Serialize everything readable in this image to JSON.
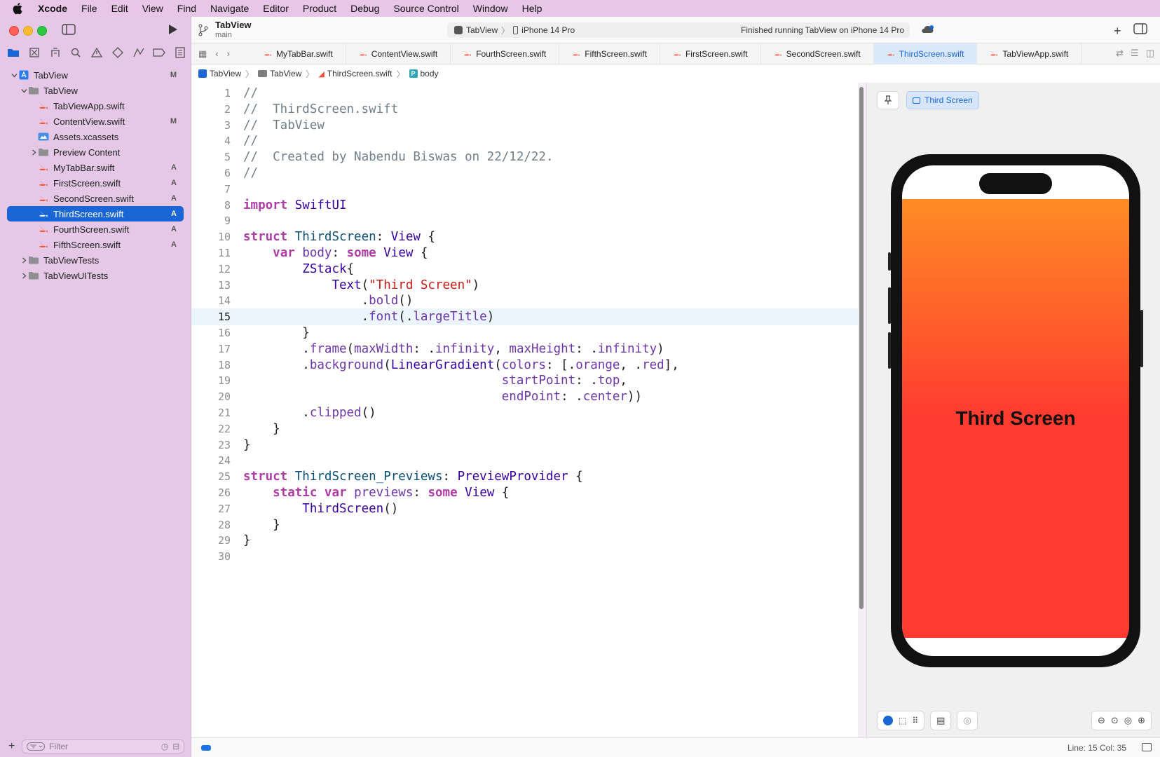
{
  "menubar": {
    "app": "Xcode",
    "items": [
      "File",
      "Edit",
      "View",
      "Find",
      "Navigate",
      "Editor",
      "Product",
      "Debug",
      "Source Control",
      "Window",
      "Help"
    ]
  },
  "navigator": {
    "tree": [
      {
        "label": "TabView",
        "badge": "M",
        "level": 0,
        "icon": "project-icon",
        "disclosure": "open"
      },
      {
        "label": "TabView",
        "badge": "",
        "level": 1,
        "icon": "folder-icon",
        "disclosure": "open"
      },
      {
        "label": "TabViewApp.swift",
        "badge": "",
        "level": 2,
        "icon": "swift-file-icon",
        "disclosure": "none"
      },
      {
        "label": "ContentView.swift",
        "badge": "M",
        "level": 2,
        "icon": "swift-file-icon",
        "disclosure": "none"
      },
      {
        "label": "Assets.xcassets",
        "badge": "",
        "level": 2,
        "icon": "assets-icon",
        "disclosure": "none"
      },
      {
        "label": "Preview Content",
        "badge": "",
        "level": 2,
        "icon": "folder-icon",
        "disclosure": "closed"
      },
      {
        "label": "MyTabBar.swift",
        "badge": "A",
        "level": 2,
        "icon": "swift-file-icon",
        "disclosure": "none"
      },
      {
        "label": "FirstScreen.swift",
        "badge": "A",
        "level": 2,
        "icon": "swift-file-icon",
        "disclosure": "none"
      },
      {
        "label": "SecondScreen.swift",
        "badge": "A",
        "level": 2,
        "icon": "swift-file-icon",
        "disclosure": "none"
      },
      {
        "label": "ThirdScreen.swift",
        "badge": "A",
        "level": 2,
        "icon": "swift-file-icon",
        "disclosure": "none",
        "selected": true
      },
      {
        "label": "FourthScreen.swift",
        "badge": "A",
        "level": 2,
        "icon": "swift-file-icon",
        "disclosure": "none"
      },
      {
        "label": "FifthScreen.swift",
        "badge": "A",
        "level": 2,
        "icon": "swift-file-icon",
        "disclosure": "none"
      },
      {
        "label": "TabViewTests",
        "badge": "",
        "level": 1,
        "icon": "folder-icon",
        "disclosure": "closed"
      },
      {
        "label": "TabViewUITests",
        "badge": "",
        "level": 1,
        "icon": "folder-icon",
        "disclosure": "closed"
      }
    ],
    "filter_placeholder": "Filter"
  },
  "toolbar": {
    "project": "TabView",
    "branch": "main",
    "scheme": "TabView",
    "destination": "iPhone 14 Pro",
    "status": "Finished running TabView on iPhone 14 Pro"
  },
  "tabs": [
    {
      "label": "MyTabBar.swift"
    },
    {
      "label": "ContentView.swift"
    },
    {
      "label": "FourthScreen.swift"
    },
    {
      "label": "FifthScreen.swift"
    },
    {
      "label": "FirstScreen.swift"
    },
    {
      "label": "SecondScreen.swift"
    },
    {
      "label": "ThirdScreen.swift",
      "active": true
    },
    {
      "label": "TabViewApp.swift"
    }
  ],
  "breadcrumb": [
    "TabView",
    "TabView",
    "ThirdScreen.swift",
    "body"
  ],
  "editor": {
    "current_line": 15,
    "lines": [
      "//",
      "//  ThirdScreen.swift",
      "//  TabView",
      "//",
      "//  Created by Nabendu Biswas on 22/12/22.",
      "//",
      "",
      "import SwiftUI",
      "",
      "struct ThirdScreen: View {",
      "    var body: some View {",
      "        ZStack{",
      "            Text(\"Third Screen\")",
      "                .bold()",
      "                .font(.largeTitle)",
      "        }",
      "        .frame(maxWidth: .infinity, maxHeight: .infinity)",
      "        .background(LinearGradient(colors: [.orange, .red],",
      "                                   startPoint: .top,",
      "                                   endPoint: .center))",
      "        .clipped()",
      "    }",
      "}",
      "",
      "struct ThirdScreen_Previews: PreviewProvider {",
      "    static var previews: some View {",
      "        ThirdScreen()",
      "    }",
      "}",
      ""
    ]
  },
  "preview": {
    "chip_label": "Third Screen",
    "screen_text": "Third Screen",
    "gradient_colors": [
      "#ff8c25",
      "#ff3b30"
    ]
  },
  "statusbar": {
    "cursor": "Line: 15  Col: 35"
  },
  "colors": {
    "accent": "#1a66d6",
    "keyword": "#ad3da4",
    "type": "#0b4f79",
    "project_type": "#3900a0",
    "string": "#c41a16",
    "comment": "#707f8c",
    "member": "#6c36a9"
  }
}
